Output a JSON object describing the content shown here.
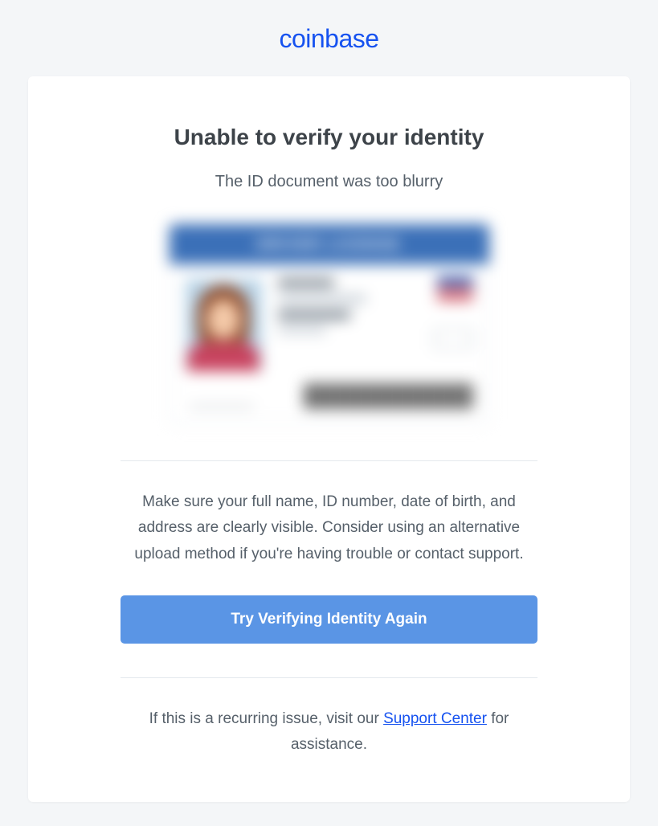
{
  "brand": {
    "logo_text": "coinbase"
  },
  "content": {
    "heading": "Unable to verify your identity",
    "subheading": "The ID document was too blurry",
    "body_text": "Make sure your full name, ID number, date of birth, and address are clearly visible. Consider using an alternative upload method if you're having trouble or contact support.",
    "cta_label": "Try Verifying Identity Again",
    "footer_prefix": "If this is a recurring issue, visit our ",
    "footer_link": "Support Center",
    "footer_suffix": " for assistance."
  },
  "illustration": {
    "header_text": "DRIVER LICENSE"
  }
}
